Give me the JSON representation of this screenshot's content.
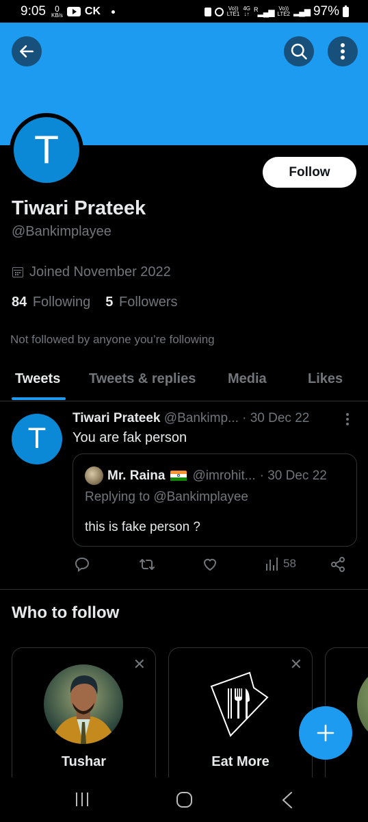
{
  "status_bar": {
    "time": "9:05",
    "data_rate_value": "0",
    "data_rate_unit": "KB/s",
    "carrier_tag": "CK",
    "sim1_label_top": "Vo))",
    "sim1_label_bottom": "LTE1",
    "network_type": "4G",
    "roaming": "R",
    "sim2_label_top": "Vo))",
    "sim2_label_bottom": "LTE2",
    "battery": "97%"
  },
  "colors": {
    "accent": "#1d9bf0",
    "banner": "#1d9bf0",
    "avatar": "#0b88d6",
    "background": "#000000",
    "muted_text": "#71767b"
  },
  "header": {
    "back_icon": "arrow-left-icon",
    "search_icon": "search-icon",
    "more_icon": "more-vertical-icon"
  },
  "profile": {
    "avatar_initial": "T",
    "follow_label": "Follow",
    "display_name": "Tiwari Prateek",
    "handle": "@Bankimplayee",
    "joined": "Joined November 2022",
    "following_count": "84",
    "following_label": "Following",
    "followers_count": "5",
    "followers_label": "Followers",
    "not_followed_text": "Not followed by anyone you’re following"
  },
  "tabs": [
    {
      "label": "Tweets",
      "active": true
    },
    {
      "label": "Tweets & replies",
      "active": false
    },
    {
      "label": "Media",
      "active": false
    },
    {
      "label": "Likes",
      "active": false
    }
  ],
  "tweet": {
    "avatar_initial": "T",
    "author_name": "Tiwari Prateek",
    "author_handle": "@Bankimp...",
    "date": "· 30 Dec 22",
    "text": "You are fak person",
    "quote": {
      "author_name": "Mr. Raina",
      "author_flag": "india-flag",
      "author_handle": "@imrohit...",
      "date": "· 30 Dec 22",
      "replying_to": "Replying to @Bankimplayee",
      "text": "this is fake person ?"
    },
    "actions": {
      "reply_count": "",
      "retweet_count": "",
      "like_count": "",
      "views_count": "58"
    }
  },
  "who_to_follow": {
    "title": "Who to follow",
    "cards": [
      {
        "name": "Tushar",
        "dismiss_icon": "close-icon"
      },
      {
        "name": "Eat More",
        "dismiss_icon": "close-icon"
      }
    ]
  },
  "fab": {
    "icon": "plus-icon"
  },
  "nav_bar": {
    "recents_icon": "recents-icon",
    "home_icon": "home-icon",
    "back_icon": "back-icon"
  }
}
